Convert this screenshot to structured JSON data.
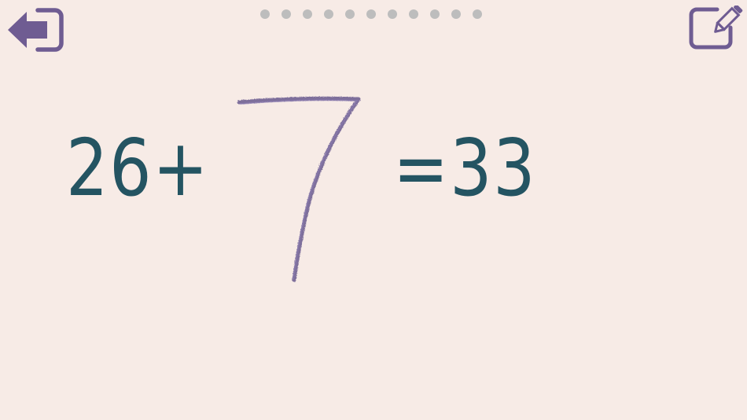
{
  "problem": {
    "left_operand": "26",
    "operator": "+",
    "result_text": "=33",
    "handwritten_answer": "7"
  },
  "progress": {
    "total_steps": 11
  },
  "colors": {
    "background": "#f7ebe6",
    "number_color": "#245462",
    "icon_color": "#6f5c92",
    "ink_color": "#6a5a8f",
    "dot_color": "#bdbdbd"
  },
  "icons": {
    "exit": "exit-arrow-icon",
    "edit": "edit-pencil-icon"
  }
}
